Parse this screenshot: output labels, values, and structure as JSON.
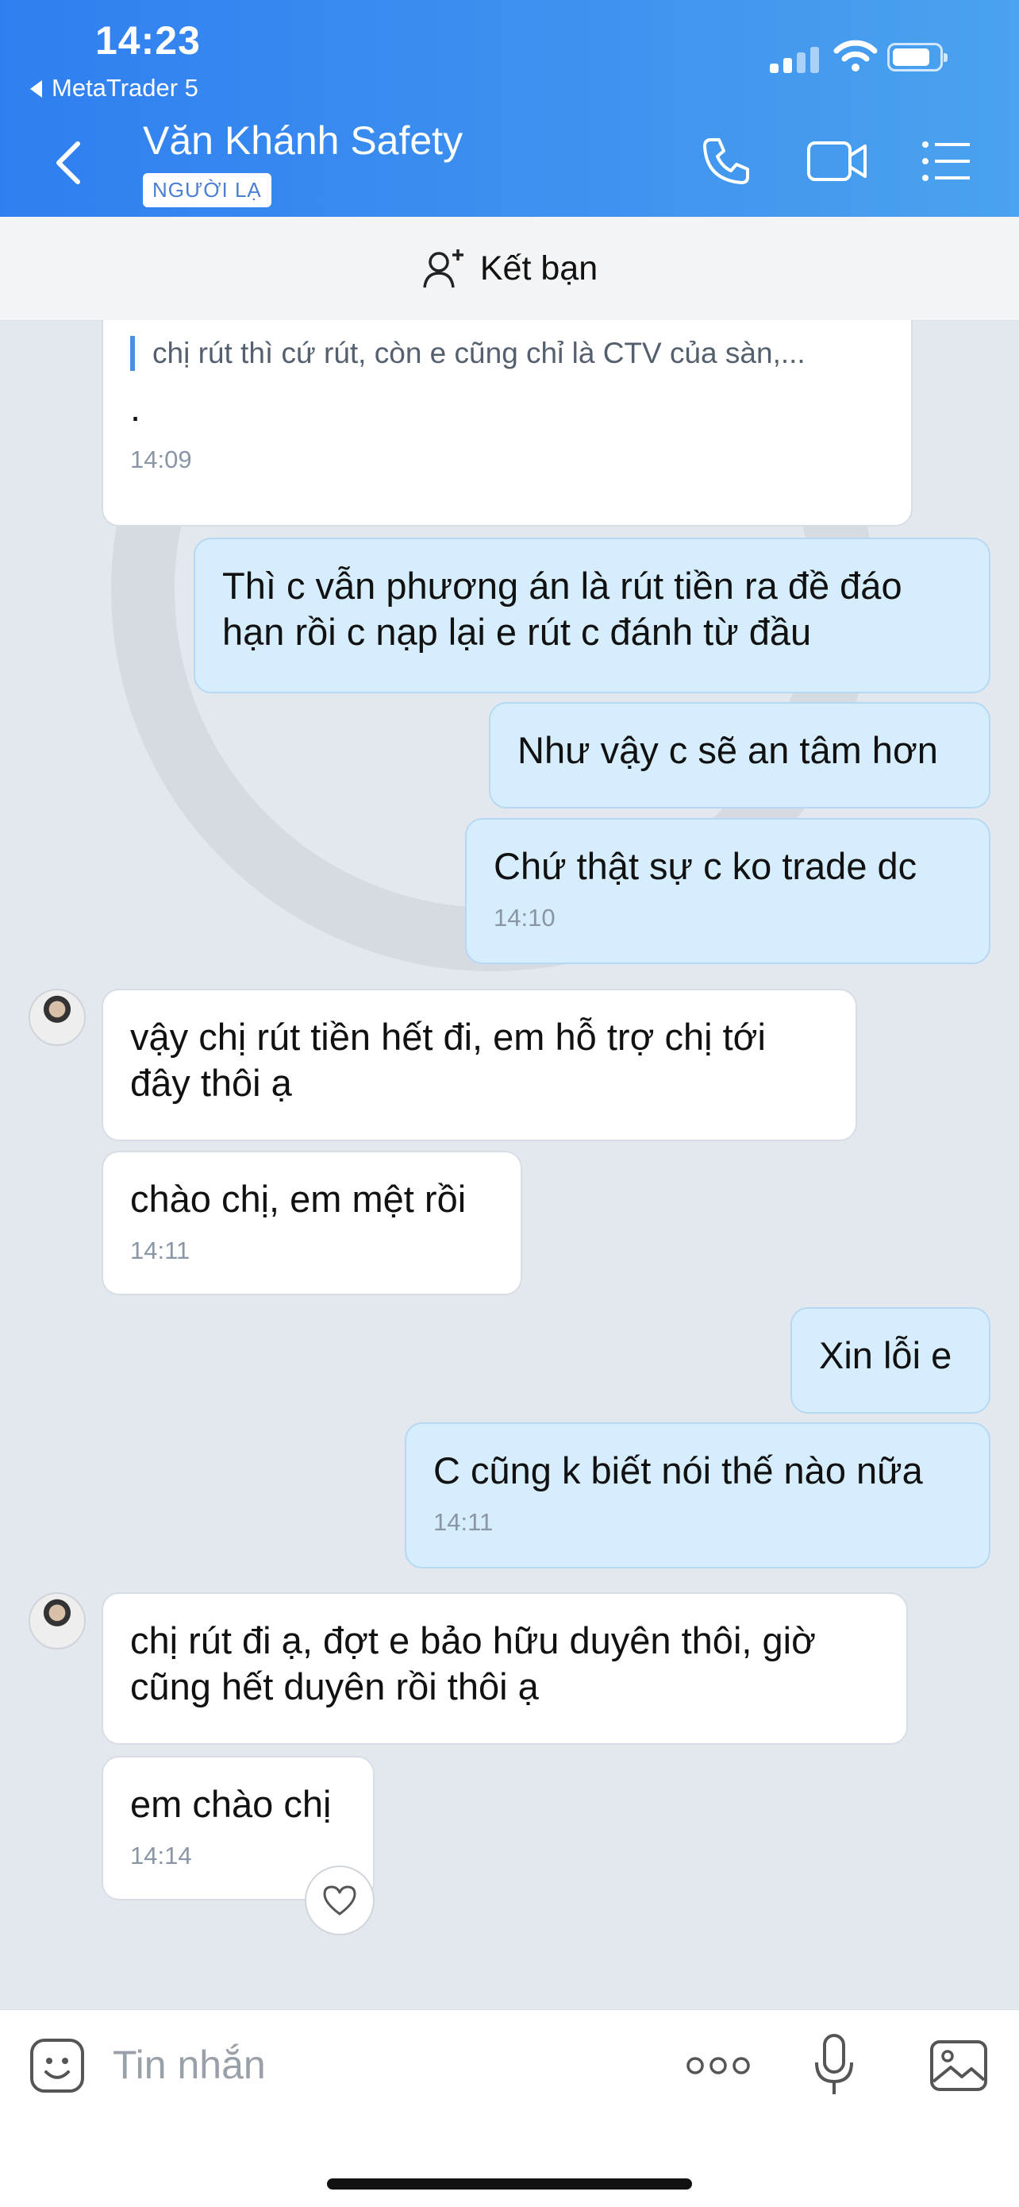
{
  "status": {
    "time": "14:23",
    "back_app": "MetaTrader 5"
  },
  "header": {
    "contact_name": "Văn Khánh Safety",
    "badge": "NGƯỜI LẠ"
  },
  "friend_bar": {
    "label": "Kết bạn"
  },
  "messages": [
    {
      "side": "in",
      "quote": "chị rút thì cứ rút, còn e cũng chỉ là CTV của sàn,...",
      "text": ".",
      "time": "14:09"
    },
    {
      "side": "out",
      "text": "Thì c vẫn phương án là rút tiền ra đề đáo hạn rồi c nạp lại e rút c đánh từ đầu"
    },
    {
      "side": "out",
      "text": "Như vậy c sẽ an tâm hơn"
    },
    {
      "side": "out",
      "text": "Chứ thật sự c ko trade dc",
      "time": "14:10"
    },
    {
      "side": "in",
      "text": "vậy chị rút tiền hết đi, em hỗ trợ chị tới đây thôi ạ"
    },
    {
      "side": "in",
      "text": "chào chị, em mệt rồi",
      "time": "14:11"
    },
    {
      "side": "out",
      "text": "Xin lỗi e"
    },
    {
      "side": "out",
      "text": "C cũng k biết nói thế nào nữa",
      "time": "14:11"
    },
    {
      "side": "in",
      "text": "chị rút đi ạ, đợt e bảo hữu duyên thôi, giờ cũng hết duyên rồi thôi ạ"
    },
    {
      "side": "in",
      "text": "em chào chị",
      "time": "14:14"
    }
  ],
  "input": {
    "placeholder": "Tin nhắn"
  },
  "icons": [
    "back-arrow-icon",
    "phone-icon",
    "video-icon",
    "menu-icon",
    "add-friend-icon",
    "heart-icon",
    "sticker-icon",
    "more-icon",
    "mic-icon",
    "image-icon"
  ],
  "colors": {
    "header": "#3a8cf0",
    "outgoing_bubble": "#d6edfd",
    "incoming_bubble": "#ffffff",
    "chat_bg": "#e3e8ef"
  }
}
